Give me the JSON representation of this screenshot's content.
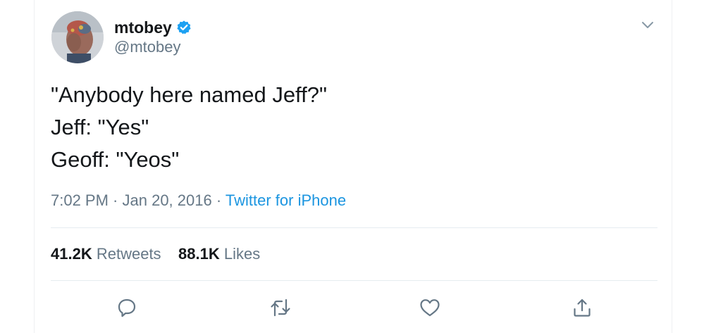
{
  "user": {
    "display_name": "mtobey",
    "handle": "@mtobey",
    "verified": true
  },
  "tweet": {
    "lines": [
      "\"Anybody here named Jeff?\"",
      "Jeff: \"Yes\"",
      "Geoff: \"Yeos\""
    ]
  },
  "meta": {
    "time": "7:02 PM",
    "separator": " · ",
    "date": "Jan 20, 2016",
    "source": "Twitter for iPhone"
  },
  "stats": {
    "retweets_count": "41.2K",
    "retweets_label": "Retweets",
    "likes_count": "88.1K",
    "likes_label": "Likes"
  },
  "icons": {
    "verified": "verified-badge-icon",
    "menu": "chevron-down-icon",
    "reply": "reply-icon",
    "retweet": "retweet-icon",
    "like": "heart-icon",
    "share": "share-icon"
  },
  "colors": {
    "text": "#14171a",
    "secondary": "#657786",
    "accent": "#1b95e0",
    "verified": "#1da1f2",
    "divider": "#e6ecf0"
  }
}
